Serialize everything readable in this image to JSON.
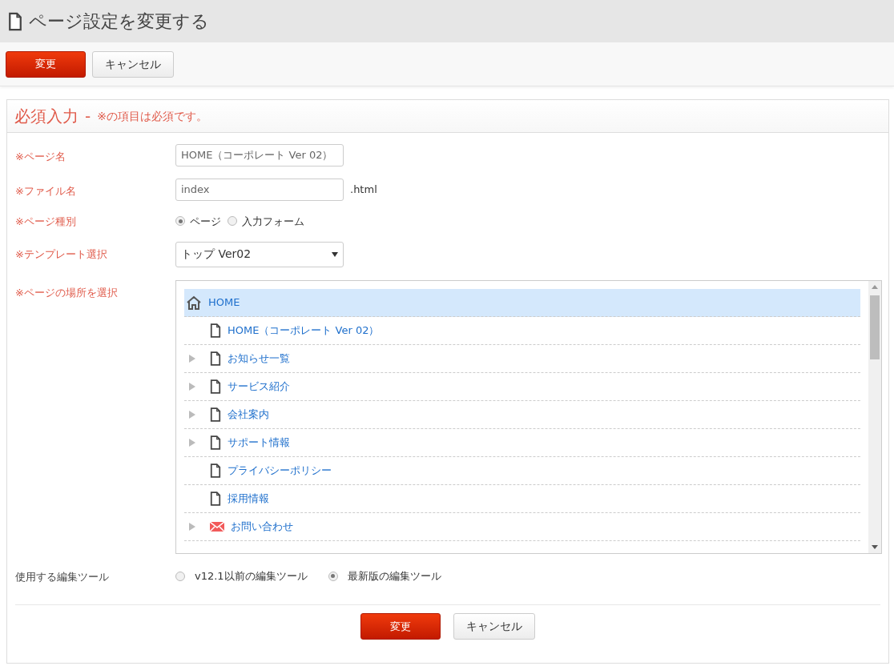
{
  "page_title": "ページ設定を変更する",
  "toolbar": {
    "buttons": [
      {
        "label": "変更",
        "kind": "primary"
      },
      {
        "label": "キャンセル",
        "kind": "default"
      }
    ]
  },
  "form": {
    "heading": "必須入力",
    "heading_separator": "-",
    "note": "※の項目は必須です。",
    "fields": [
      {
        "kind": "text",
        "label": "※ページ名",
        "required": true,
        "value": "HOME（コーポレート Ver 02）"
      },
      {
        "kind": "text",
        "label": "※ファイル名",
        "required": true,
        "value": "index",
        "suffix": ".html"
      },
      {
        "kind": "radio",
        "label": "※ページ種別",
        "required": true,
        "options": [
          {
            "label": "ページ",
            "selected": true
          },
          {
            "label": "入力フォーム",
            "selected": false
          }
        ]
      },
      {
        "kind": "select",
        "label": "※テンプレート選択",
        "required": true,
        "value": "トップ Ver02"
      },
      {
        "kind": "tree",
        "label": "※ページの場所を選択",
        "required": true,
        "nodes": [
          {
            "label": "HOME",
            "kind": "home",
            "expandable": false,
            "selected": true,
            "children": [
              {
                "label": "HOME（コーポレート Ver 02）",
                "kind": "page",
                "expandable": false,
                "selected": false
              },
              {
                "label": "お知らせ一覧",
                "kind": "page",
                "expandable": true,
                "selected": false
              },
              {
                "label": "サービス紹介",
                "kind": "page",
                "expandable": true,
                "selected": false
              },
              {
                "label": "会社案内",
                "kind": "page",
                "expandable": true,
                "selected": false
              },
              {
                "label": "サポート情報",
                "kind": "page",
                "expandable": true,
                "selected": false
              },
              {
                "label": "プライバシーポリシー",
                "kind": "page",
                "expandable": false,
                "selected": false
              },
              {
                "label": "採用情報",
                "kind": "page",
                "expandable": false,
                "selected": false
              },
              {
                "label": "お問い合わせ",
                "kind": "mail",
                "expandable": true,
                "selected": false
              }
            ]
          }
        ]
      },
      {
        "kind": "radio",
        "label": "使用する編集ツール",
        "required": false,
        "options": [
          {
            "label": "v12.1以前の編集ツール",
            "selected": false
          },
          {
            "label": "最新版の編集ツール",
            "selected": true
          }
        ]
      }
    ]
  },
  "footer": {
    "buttons": [
      {
        "label": "変更",
        "kind": "primary"
      },
      {
        "label": "キャンセル",
        "kind": "default"
      }
    ]
  }
}
